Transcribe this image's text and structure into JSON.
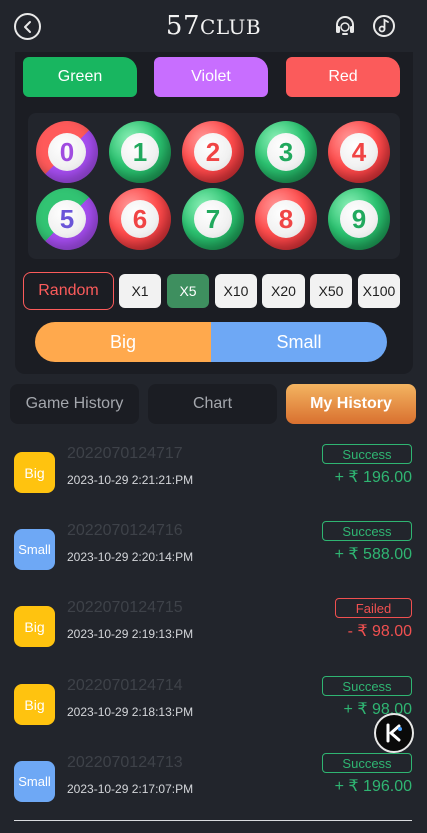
{
  "header": {
    "logo_num": "57",
    "logo_text": "CLUB",
    "back_icon": "back-arrow-icon",
    "support_icon": "headset-icon",
    "music_icon": "music-note-icon"
  },
  "colors": {
    "green": "Green",
    "violet": "Violet",
    "red": "Red"
  },
  "balls": [
    {
      "number": "0",
      "color": "red-violet"
    },
    {
      "number": "1",
      "color": "green"
    },
    {
      "number": "2",
      "color": "red"
    },
    {
      "number": "3",
      "color": "green"
    },
    {
      "number": "4",
      "color": "red"
    },
    {
      "number": "5",
      "color": "green-violet"
    },
    {
      "number": "6",
      "color": "red"
    },
    {
      "number": "7",
      "color": "green"
    },
    {
      "number": "8",
      "color": "red"
    },
    {
      "number": "9",
      "color": "green"
    }
  ],
  "multipliers": {
    "random": "Random",
    "options": [
      "X1",
      "X5",
      "X10",
      "X20",
      "X50",
      "X100"
    ],
    "selected": "X5"
  },
  "size": {
    "big": "Big",
    "small": "Small"
  },
  "tabs": {
    "game_history": "Game History",
    "chart": "Chart",
    "my_history": "My History",
    "active": "My History"
  },
  "history": [
    {
      "type": "Big",
      "issue": "2022070124717",
      "time": "2023-10-29 2:21:21:PM",
      "status": "Success",
      "amount": "+ ₹ 196.00"
    },
    {
      "type": "Small",
      "issue": "2022070124716",
      "time": "2023-10-29 2:20:14:PM",
      "status": "Success",
      "amount": "+ ₹ 588.00"
    },
    {
      "type": "Big",
      "issue": "2022070124715",
      "time": "2023-10-29 2:19:13:PM",
      "status": "Failed",
      "amount": "- ₹ 98.00"
    },
    {
      "type": "Big",
      "issue": "2022070124714",
      "time": "2023-10-29 2:18:13:PM",
      "status": "Success",
      "amount": "+ ₹ 98.00"
    },
    {
      "type": "Small",
      "issue": "2022070124713",
      "time": "2023-10-29 2:17:07:PM",
      "status": "Success",
      "amount": "+ ₹ 196.00"
    }
  ],
  "floating_button": {
    "icon": "k-logo-icon"
  }
}
